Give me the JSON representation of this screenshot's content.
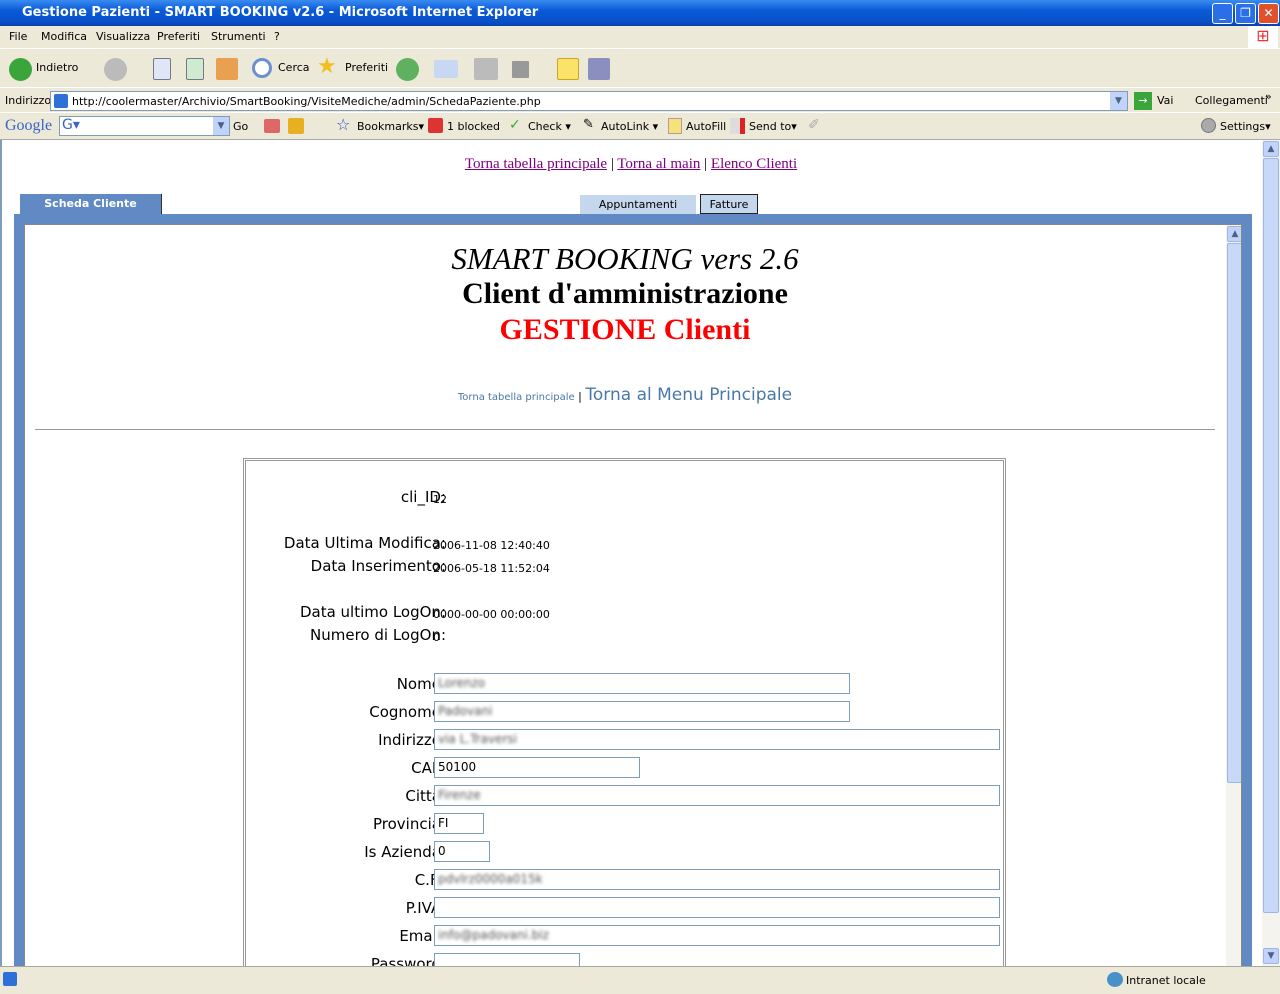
{
  "window": {
    "title": "Gestione Pazienti - SMART BOOKING v2.6 - Microsoft Internet Explorer"
  },
  "menu": [
    "File",
    "Modifica",
    "Visualizza",
    "Preferiti",
    "Strumenti",
    "?"
  ],
  "toolbar": {
    "back": "Indietro",
    "search": "Cerca",
    "favorites": "Preferiti"
  },
  "address": {
    "label": "Indirizzo",
    "url": "http://coolermaster/Archivio/SmartBooking/VisiteMediche/admin/SchedaPaziente.php",
    "go": "Vai",
    "links": "Collegamenti"
  },
  "google": {
    "logo": "Google",
    "go": "Go",
    "bookmarks": "Bookmarks",
    "blocked": "1 blocked",
    "check": "Check",
    "autolink": "AutoLink",
    "autofill": "AutoFill",
    "sendto": "Send to",
    "settings": "Settings"
  },
  "nav": {
    "link1": "Torna tabella principale",
    "link2": "Torna al main",
    "link3": "Elenco Clienti"
  },
  "tabs": {
    "active": "Scheda Cliente",
    "t2": "Appuntamenti",
    "t3": "Fatture"
  },
  "header": {
    "title": "SMART BOOKING vers 2.6",
    "subtitle": "Client d'amministrazione",
    "section": "GESTIONE Clienti",
    "small_link": "Torna tabella principale",
    "big_link": "Torna al Menu Principale"
  },
  "info": [
    {
      "label": "cli_ID:",
      "value": "12"
    },
    {
      "label": "Data Ultima Modifica:",
      "value": "2006-11-08 12:40:40"
    },
    {
      "label": "Data Inserimento:",
      "value": "2006-05-18 11:52:04"
    },
    {
      "label": "Data ultimo LogOn:",
      "value": "0000-00-00 00:00:00"
    },
    {
      "label": "Numero di LogOn:",
      "value": "0"
    }
  ],
  "fields": [
    {
      "label": "Nome:",
      "value": "Lorenzo",
      "blurred": true
    },
    {
      "label": "Cognome:",
      "value": "Padovani",
      "blurred": true
    },
    {
      "label": "Indirizzo:",
      "value": "via L.Traversi",
      "blurred": true
    },
    {
      "label": "CAP:",
      "value": "50100"
    },
    {
      "label": "Città:",
      "value": "Firenze",
      "blurred": true
    },
    {
      "label": "Provincia:",
      "value": "FI"
    },
    {
      "label": "Is Azienda:",
      "value": "0"
    },
    {
      "label": "C.F.:",
      "value": "pdvlrz0000a015k",
      "blurred": true
    },
    {
      "label": "P.IVA:",
      "value": ""
    },
    {
      "label": "Email:",
      "value": "info@padovani.biz",
      "blurred": true
    },
    {
      "label": "Password:",
      "value": ""
    }
  ],
  "status": {
    "zone": "Intranet locale"
  }
}
